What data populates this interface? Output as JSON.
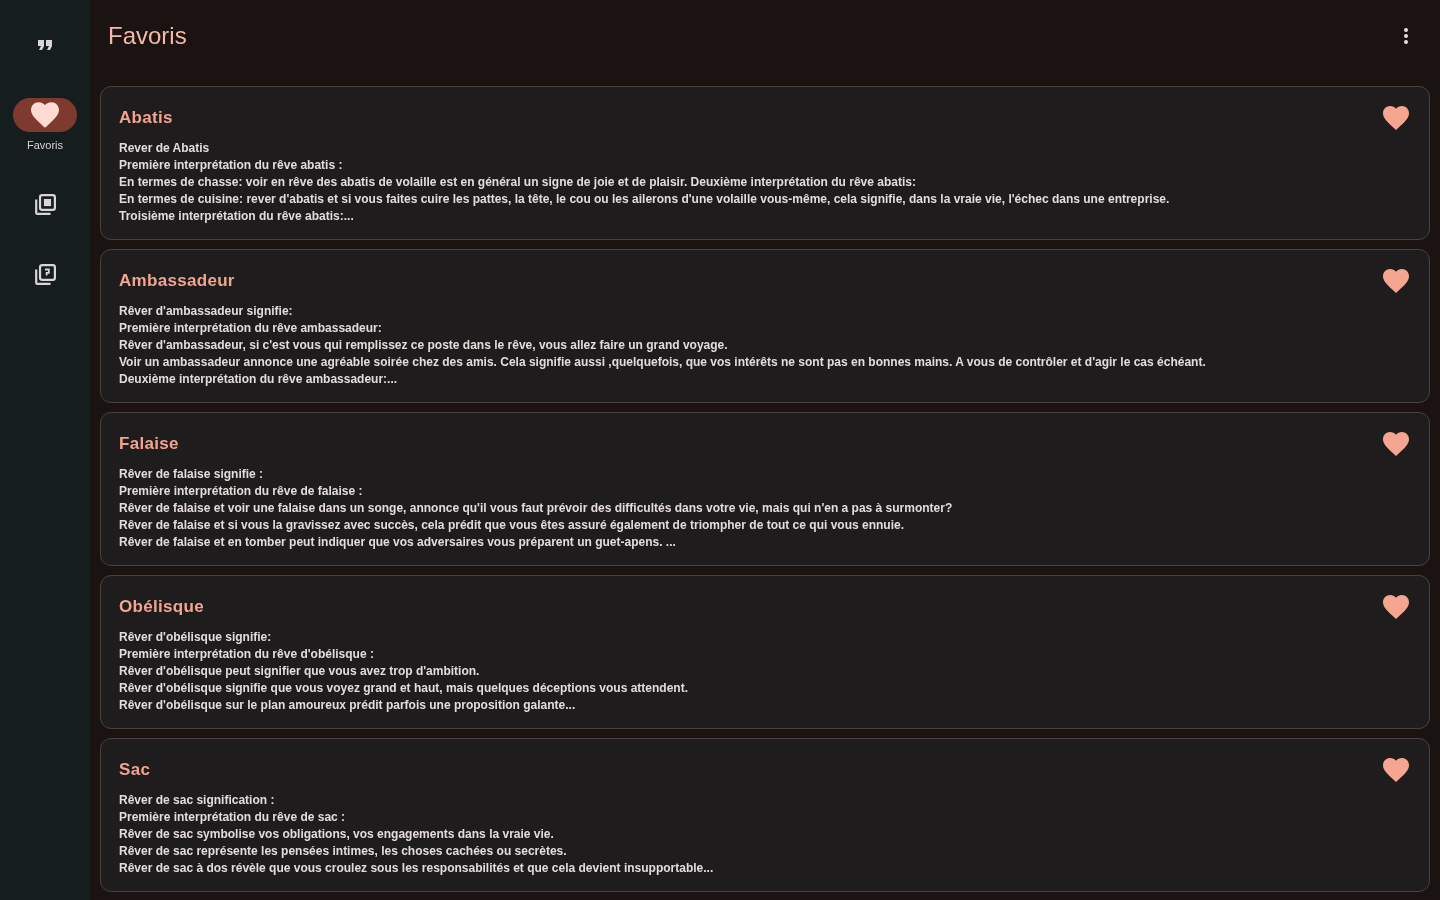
{
  "sidebar": {
    "items": [
      {
        "kind": "quote",
        "selected": false
      },
      {
        "kind": "heart",
        "label": "Favoris",
        "selected": true
      },
      {
        "kind": "gallery",
        "selected": false
      },
      {
        "kind": "pages",
        "selected": false
      }
    ]
  },
  "header": {
    "title": "Favoris"
  },
  "favorites": [
    {
      "title": "Abatis",
      "favorite": true,
      "excerpt": "Rever de Abatis\nPremière interprétation du rêve abatis :\nEn termes de chasse: voir en rêve des abatis de volaille est en général un signe de joie et de plaisir. Deuxième interprétation du rêve abatis:\nEn termes de cuisine: rever d'abatis et si vous faites cuire les pattes, la tête, le cou ou les ailerons d'une volaille vous-même, cela signifie, dans la vraie vie, l'échec dans une entreprise.\nTroisième interprétation du rêve abatis:..."
    },
    {
      "title": "Ambassadeur",
      "favorite": true,
      "excerpt": "Rêver d'ambassadeur signifie:\nPremière interprétation du rêve ambassadeur:\nRêver d'ambassadeur, si c'est vous qui remplissez ce poste dans le rêve, vous allez faire un grand voyage.\nVoir un ambassadeur annonce une agréable soirée chez des amis. Cela signifie aussi ,quelquefois, que vos intérêts ne sont pas en bonnes mains. A vous de contrôler et d'agir le cas échéant.\nDeuxième interprétation du rêve ambassadeur:..."
    },
    {
      "title": "Falaise",
      "favorite": true,
      "excerpt": "Rêver de falaise signifie :\nPremière interprétation du rêve de falaise :\nRêver de falaise et voir une falaise dans un songe, annonce qu'il vous faut prévoir des difficultés dans votre vie, mais qui n'en a pas à surmonter?\nRêver de falaise et si vous la gravissez avec succès, cela prédit que vous êtes assuré également de triompher de tout ce qui vous ennuie.\nRêver de falaise et en tomber peut indiquer que vos adversaires vous préparent un guet-apens. ..."
    },
    {
      "title": "Obélisque",
      "favorite": true,
      "excerpt": "Rêver d'obélisque signifie:\nPremière interprétation du rêve d'obélisque :\nRêver d'obélisque peut signifier que vous avez trop d'ambition.\nRêver d'obélisque signifie que vous voyez grand et haut, mais quelques déceptions vous attendent.\nRêver d'obélisque sur le plan amoureux prédit parfois une proposition galante..."
    },
    {
      "title": "Sac",
      "favorite": true,
      "excerpt": "Rêver de sac signification :\nPremière interprétation du rêve de sac :\nRêver de sac symbolise vos obligations, vos engagements dans la vraie vie.\nRêver de sac représente les pensées intimes, les choses cachées ou secrètes.\nRêver de sac à dos révèle que vous croulez sous les responsabilités et que cela devient insupportable..."
    }
  ]
}
